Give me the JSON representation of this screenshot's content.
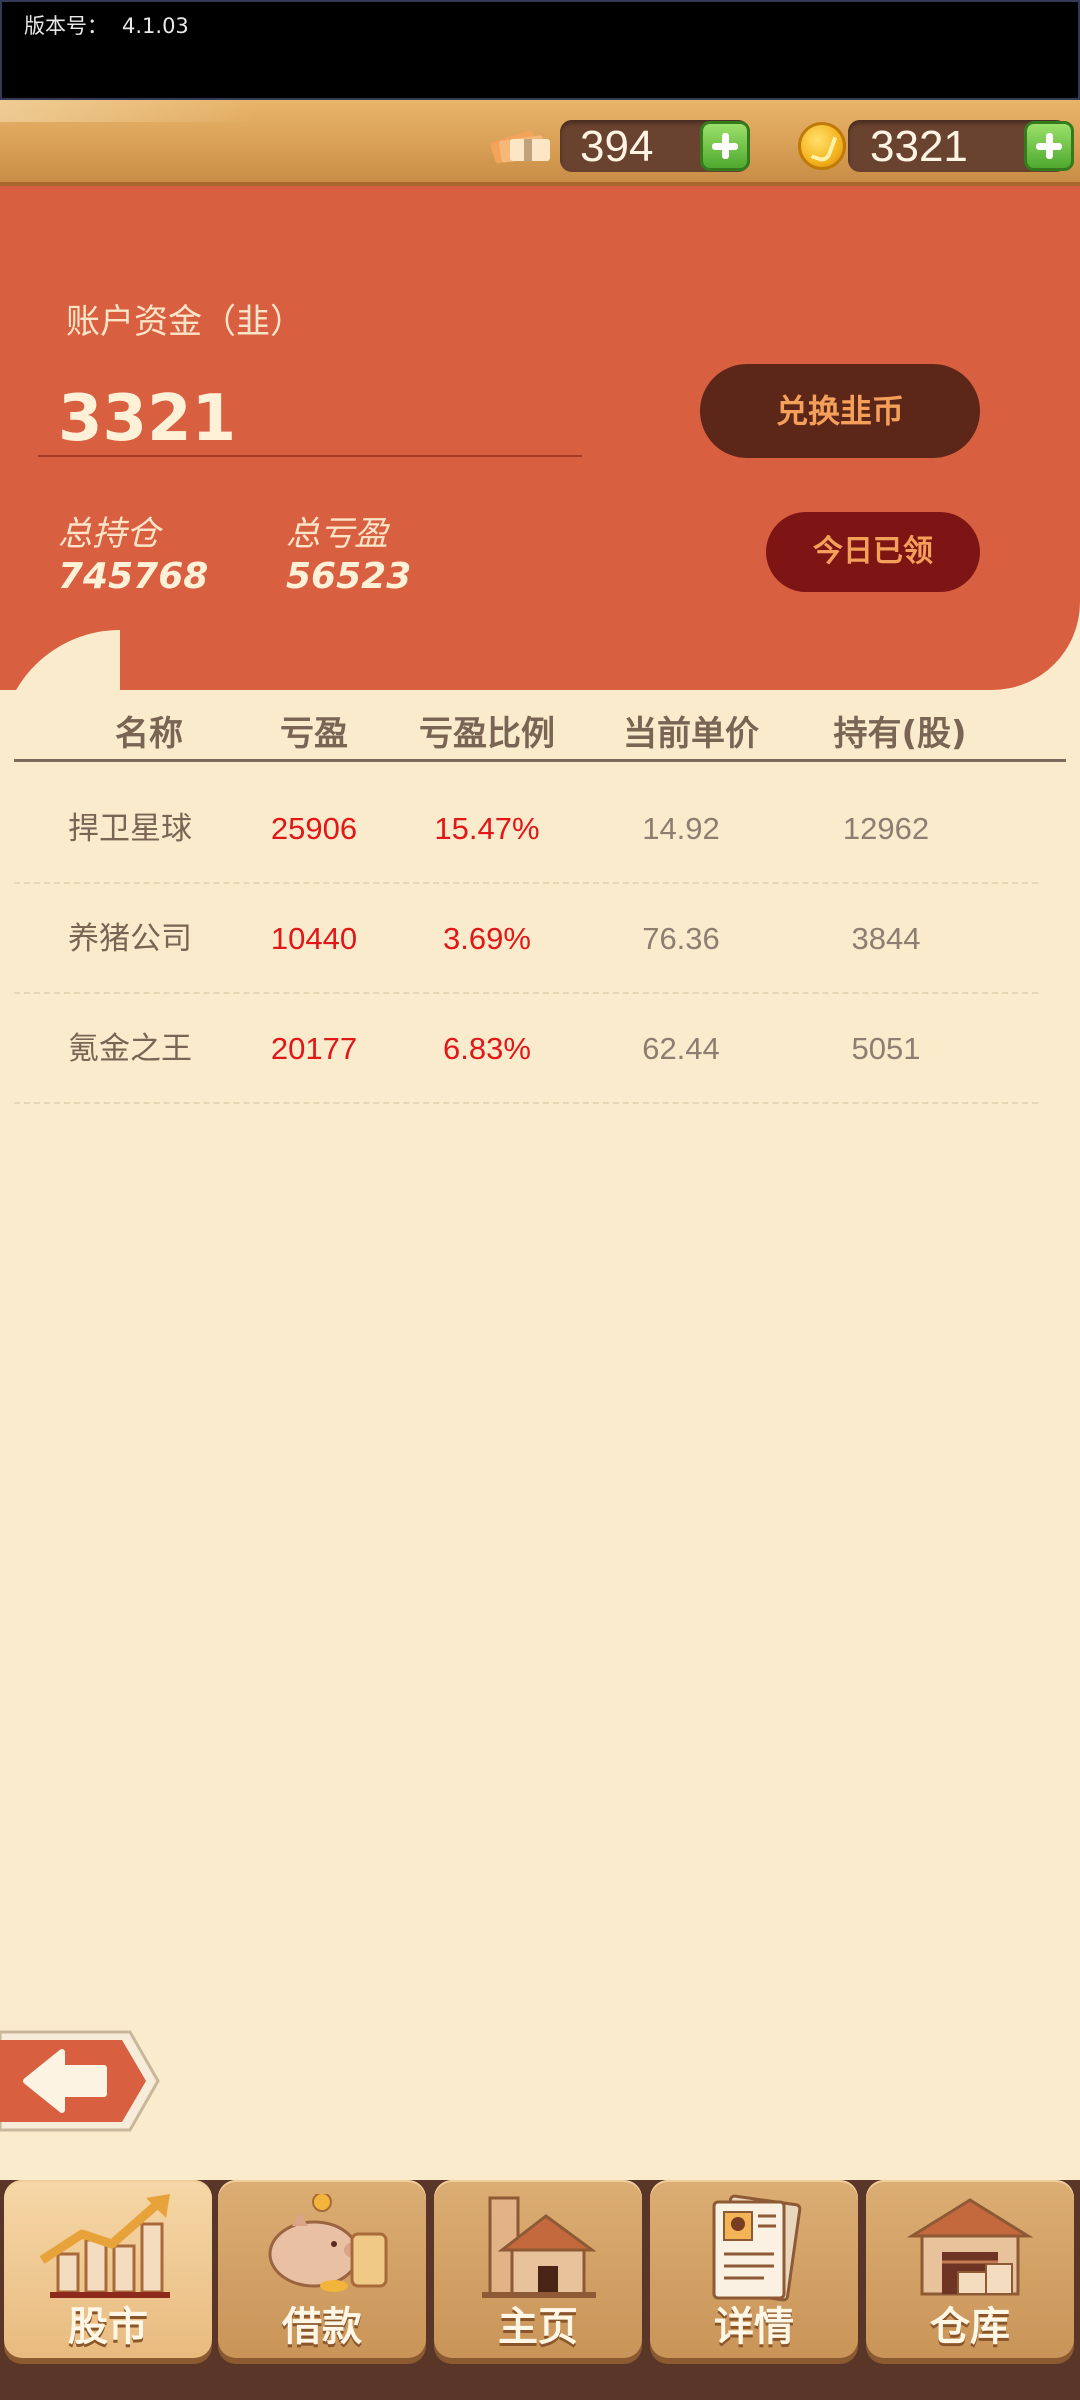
{
  "status_bar": {
    "version_label": "版本号：",
    "version_value": "4.1.03"
  },
  "header": {
    "cash_amount": "394",
    "coin_amount": "3321"
  },
  "account": {
    "label": "账户资金（韭）",
    "balance": "3321",
    "total_position_label": "总持仓",
    "total_position_value": "745768",
    "total_pnl_label": "总亏盈",
    "total_pnl_value": "56523",
    "exchange_button": "兑换韭币",
    "daily_claimed_button": "今日已领"
  },
  "table": {
    "headers": [
      "名称",
      "亏盈",
      "亏盈比例",
      "当前单价",
      "持有(股)"
    ],
    "rows": [
      {
        "name": "捍卫星球",
        "pnl": "25906",
        "pnl_ratio": "15.47%",
        "price": "14.92",
        "holding": "12962"
      },
      {
        "name": "养猪公司",
        "pnl": "10440",
        "pnl_ratio": "3.69%",
        "price": "76.36",
        "holding": "3844"
      },
      {
        "name": "氪金之王",
        "pnl": "20177",
        "pnl_ratio": "6.83%",
        "price": "62.44",
        "holding": "5051"
      }
    ]
  },
  "nav": {
    "tabs": [
      {
        "label": "股市",
        "icon": "stock-chart-icon",
        "active": true
      },
      {
        "label": "借款",
        "icon": "piggy-bank-icon",
        "active": false
      },
      {
        "label": "主页",
        "icon": "home-icon",
        "active": false
      },
      {
        "label": "详情",
        "icon": "profile-document-icon",
        "active": false
      },
      {
        "label": "仓库",
        "icon": "warehouse-icon",
        "active": false
      }
    ]
  },
  "colors": {
    "panel": "#d95f41",
    "background": "#faebcd",
    "profit_red": "#e01818",
    "exchange_button": "#5c2718",
    "claimed_button": "#7e1515"
  }
}
